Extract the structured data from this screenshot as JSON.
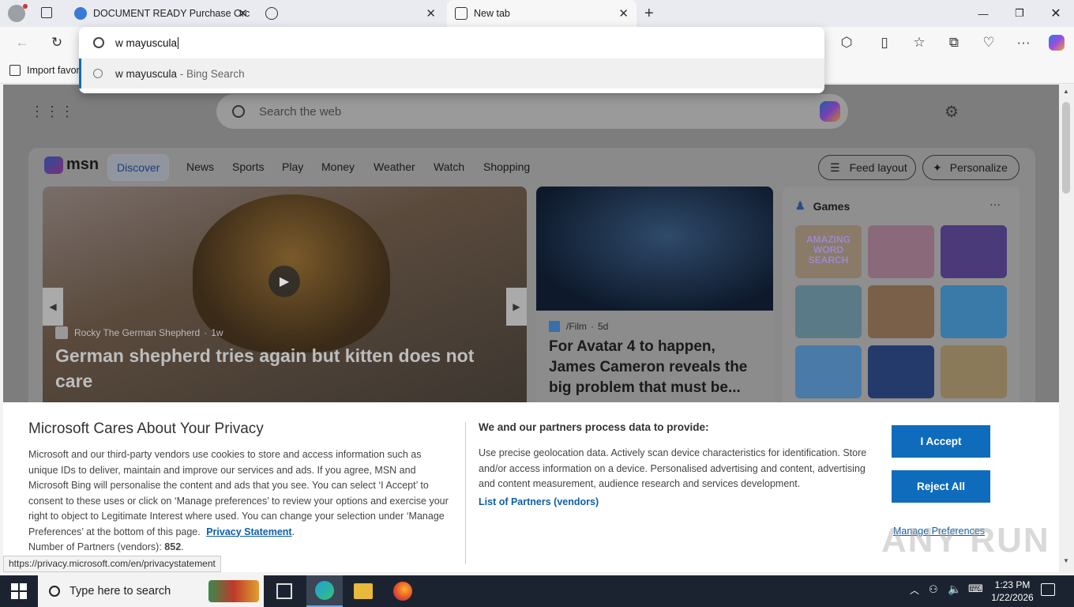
{
  "browser": {
    "tabs": [
      {
        "title": "DOCUMENT READY Purchase Orc",
        "icon": "site-icon"
      },
      {
        "title": "",
        "icon": "globe-icon"
      },
      {
        "title": "New tab",
        "icon": "newtab-icon"
      }
    ],
    "omnibox": {
      "value": "w mayuscula",
      "suggestion_text": "w mayuscula",
      "suggestion_suffix": " - Bing Search"
    },
    "favbar": {
      "import_label": "Import favor"
    },
    "status_url": "https://privacy.microsoft.com/en/privacystatement"
  },
  "newtab": {
    "search_placeholder": "Search the web",
    "msn_logo": "msn",
    "nav": [
      "Discover",
      "News",
      "Sports",
      "Play",
      "Money",
      "Weather",
      "Watch",
      "Shopping"
    ],
    "feed_layout_label": "Feed layout",
    "personalize_label": "Personalize",
    "hero": {
      "source": "Rocky The German Shepherd",
      "age": "1w",
      "title": "German shepherd tries again but kitten does not care"
    },
    "article2": {
      "source": "/Film",
      "age": "5d",
      "title": "For Avatar 4 to happen, James Cameron reveals the big problem that must be..."
    },
    "games": {
      "title": "Games",
      "more": "···",
      "tile1_text": "AMAZING WORD SEARCH"
    }
  },
  "privacy": {
    "title": "Microsoft Cares About Your Privacy",
    "body": "Microsoft and our third-party vendors use cookies to store and access information such as unique IDs to deliver, maintain and improve our services and ads. If you agree, MSN and Microsoft Bing will personalise the content and ads that you see. You can select ‘I Accept’ to consent to these uses or click on ‘Manage preferences’ to review your options and exercise your right to object to Legitimate Interest where used.  You can change your selection under ‘Manage Preferences’ at the bottom of this page.",
    "privacy_statement_link": "Privacy Statement",
    "partners_label": "Number of Partners (vendors):",
    "partners_count": "852",
    "process_title": "We and our partners process data to provide:",
    "process_body": "Use precise geolocation data. Actively scan device characteristics for identification. Store and/or access information on a device. Personalised advertising and content, advertising and content measurement, audience research and services development.",
    "partners_link": "List of Partners (vendors)",
    "accept_label": "I Accept",
    "reject_label": "Reject All",
    "manage_label": "Manage Preferences"
  },
  "taskbar": {
    "search_placeholder": "Type here to search",
    "time": "1:23 PM",
    "date": "1/22/2026"
  },
  "watermark": "ANY RUN"
}
